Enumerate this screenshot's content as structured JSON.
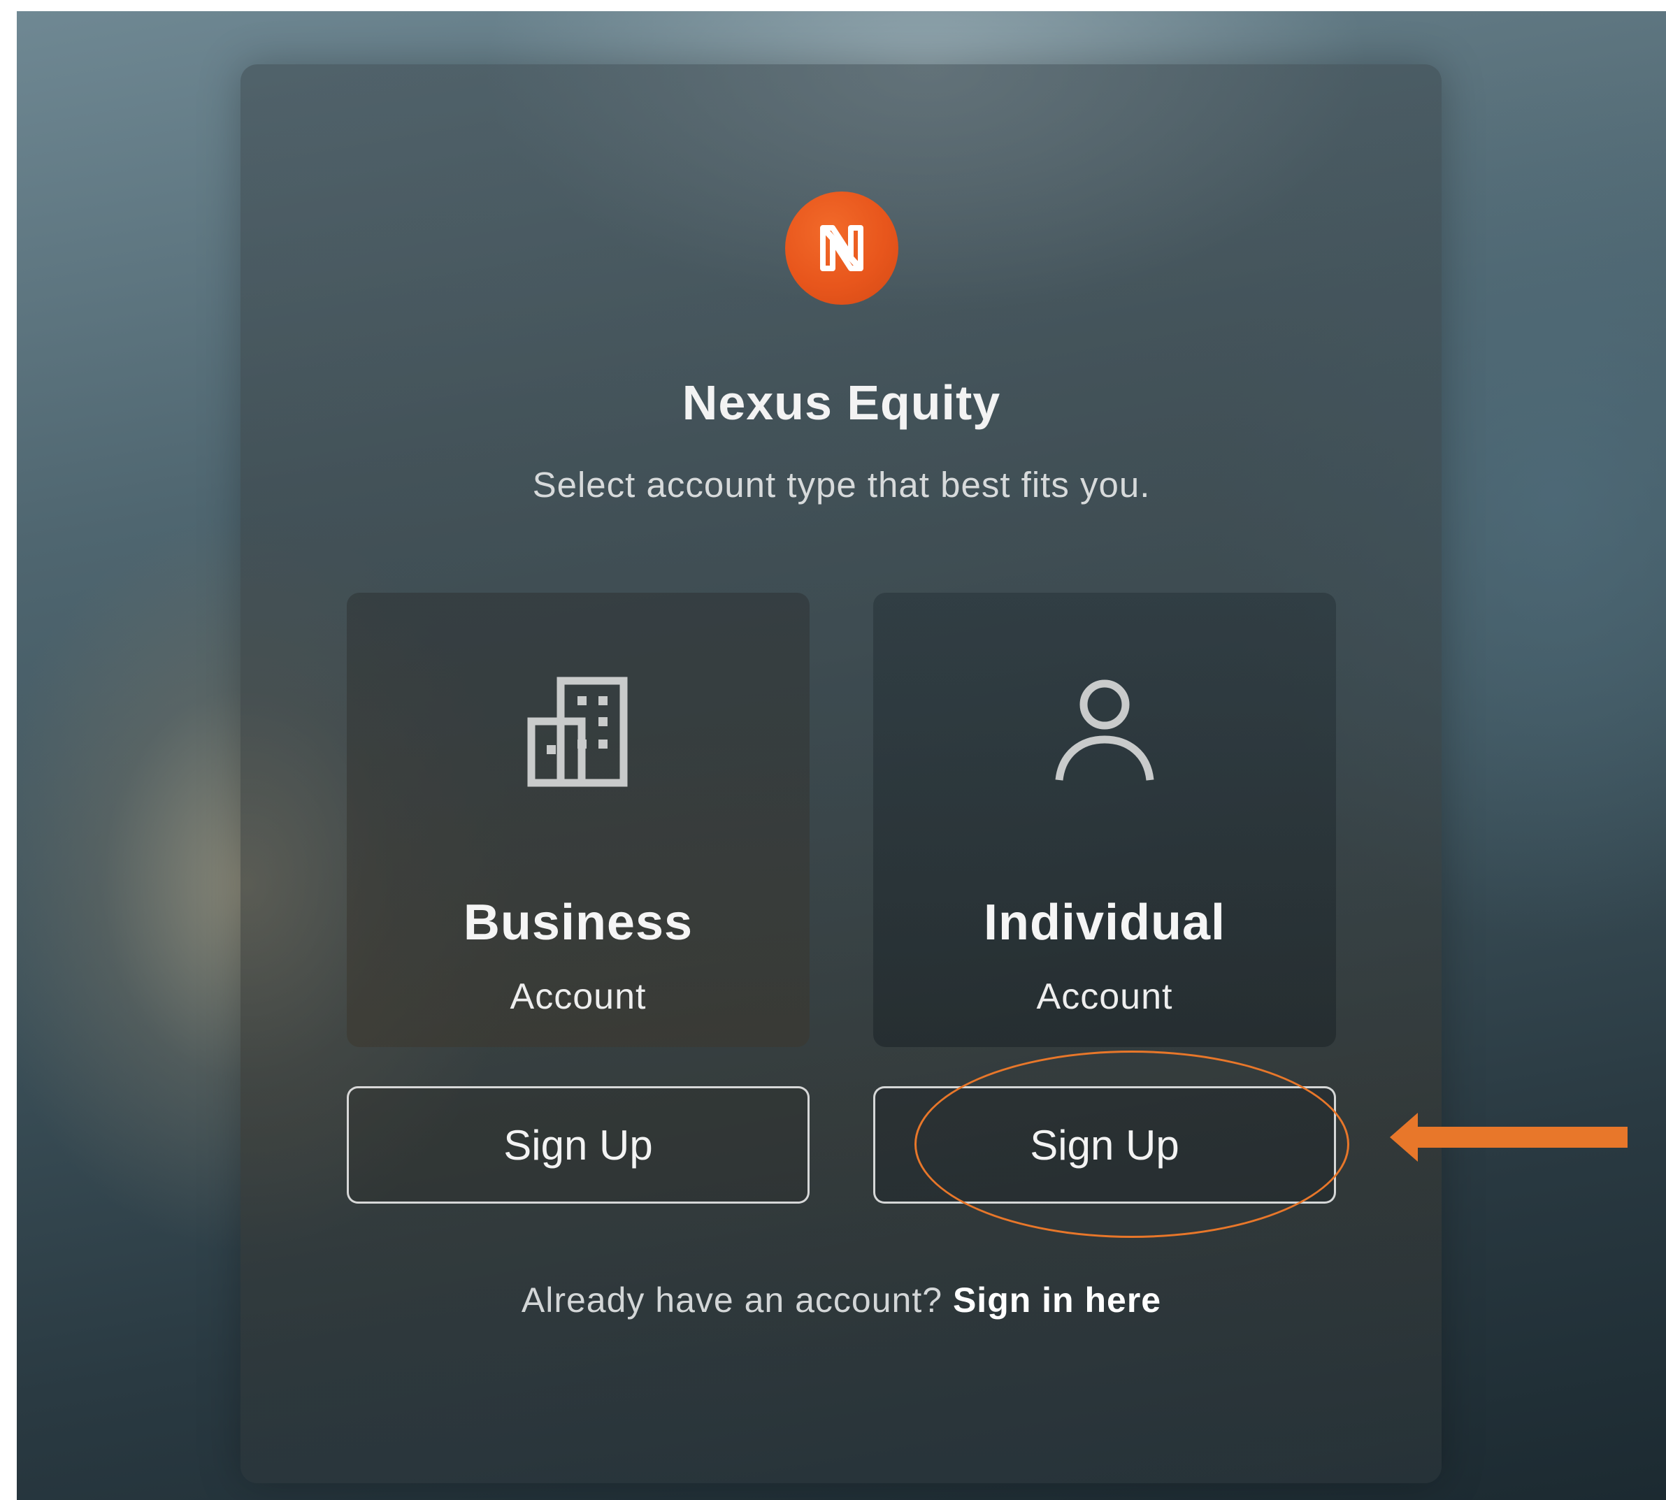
{
  "brand": {
    "logo_letter": "N",
    "name": "Nexus Equity",
    "tagline": "Select account type that best fits you."
  },
  "cards": [
    {
      "icon": "building-icon",
      "title": "Business",
      "subtitle": "Account",
      "button_label": "Sign Up"
    },
    {
      "icon": "user-icon",
      "title": "Individual",
      "subtitle": "Account",
      "button_label": "Sign Up"
    }
  ],
  "footer": {
    "prompt": "Already have an account?",
    "link_label": "Sign in here"
  },
  "annotation": {
    "highlight": "orange-ellipse",
    "pointer": "orange-arrow-left",
    "color": "#e8772a"
  },
  "colors": {
    "logo": "#e8561c",
    "text_primary": "#f5f5f5",
    "text_secondary": "#d7dadb"
  }
}
